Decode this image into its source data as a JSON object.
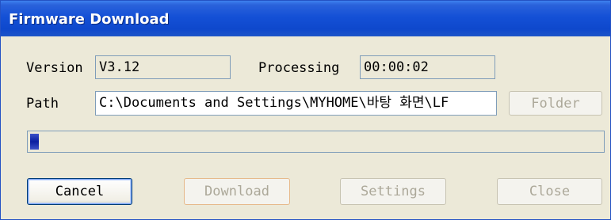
{
  "window": {
    "title": "Firmware Download"
  },
  "version": {
    "label": "Version",
    "value": "V3.12"
  },
  "processing": {
    "label": "Processing",
    "value": "00:00:02"
  },
  "path": {
    "label": "Path",
    "value": "C:\\Documents and Settings\\MYHOME\\바탕 화면\\LF"
  },
  "progress": {
    "fraction": 0.015
  },
  "buttons": {
    "folder": "Folder",
    "cancel": "Cancel",
    "download": "Download",
    "settings": "Settings",
    "close": "Close"
  }
}
